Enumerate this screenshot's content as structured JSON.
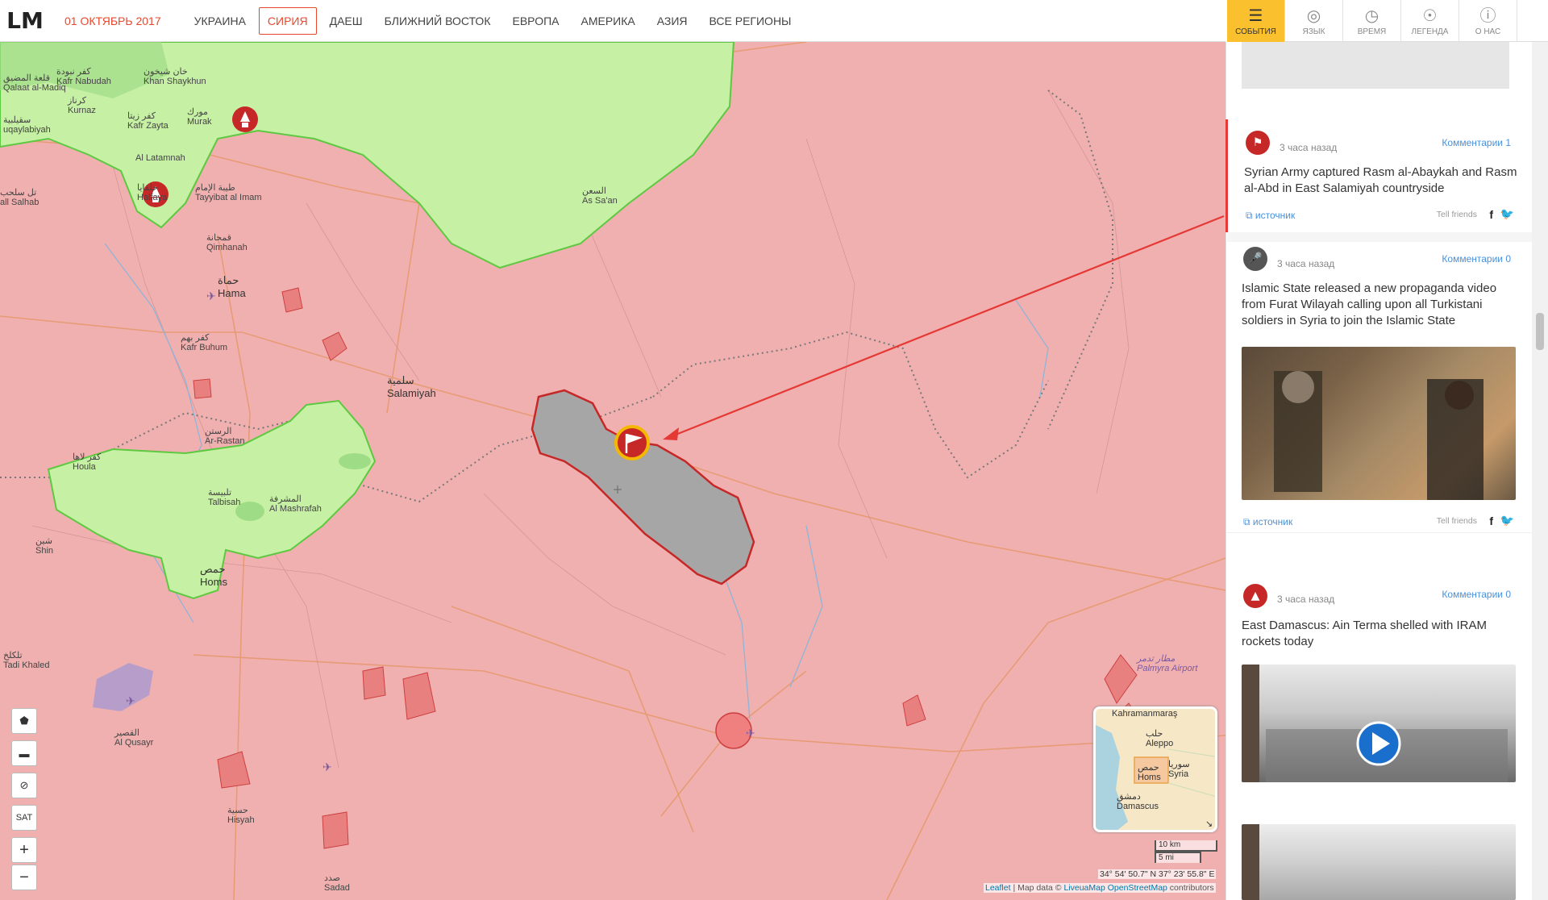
{
  "header": {
    "logo": "LM",
    "date": "01 ОКТЯБРЬ 2017",
    "nav": [
      "УКРАИНА",
      "СИРИЯ",
      "ДАЕШ",
      "БЛИЖНИЙ ВОСТОК",
      "ЕВРОПА",
      "АМЕРИКА",
      "АЗИЯ",
      "ВСЕ РЕГИОНЫ"
    ],
    "active_nav": "СИРИЯ"
  },
  "toolbar": {
    "events_label": "СОБЫТИЯ",
    "language_label": "ЯЗЫК",
    "time_label": "ВРЕМЯ",
    "legend_label": "ЛЕГЕНДА",
    "about_label": "О НАС"
  },
  "map": {
    "places": [
      {
        "name": "Khan Shaykhun",
        "ar": "خان شيخون"
      },
      {
        "name": "Kafr Nabudah",
        "ar": "كفر نبودة"
      },
      {
        "name": "Qalaat al-Madiq",
        "ar": "قلعة المضيق"
      },
      {
        "name": "Kurnaz",
        "ar": "كرناز"
      },
      {
        "name": "Kafr Zayta",
        "ar": "كفر زيتا"
      },
      {
        "name": "Murak",
        "ar": "مورك"
      },
      {
        "name": "uqaylabiyah",
        "ar": "سقيلبية"
      },
      {
        "name": "Al Latamnah",
        "ar": ""
      },
      {
        "name": "Halfaya",
        "ar": "حلفايا"
      },
      {
        "name": "Tayyibat al Imam",
        "ar": "طيبة الإمام"
      },
      {
        "name": "all Salhab",
        "ar": "تل سلحب"
      },
      {
        "name": "Qimhanah",
        "ar": "قمحانة"
      },
      {
        "name": "Hama",
        "ar": "حماة"
      },
      {
        "name": "Kafr Buhum",
        "ar": "كفر بهم"
      },
      {
        "name": "Salamiyah",
        "ar": "سلمية"
      },
      {
        "name": "As Sa'an",
        "ar": "السعن"
      },
      {
        "name": "Ar-Rastan",
        "ar": "الرستن"
      },
      {
        "name": "Houla",
        "ar": "كفر لاها"
      },
      {
        "name": "Talbisah",
        "ar": "تلبيسة"
      },
      {
        "name": "Al Mashrafah",
        "ar": "المشرفة"
      },
      {
        "name": "Shin",
        "ar": "شين"
      },
      {
        "name": "Homs",
        "ar": "حمص"
      },
      {
        "name": "Tadi Khaled",
        "ar": "تلكلخ"
      },
      {
        "name": "Al Qusayr",
        "ar": "القصير"
      },
      {
        "name": "Hisyah",
        "ar": "حسية"
      },
      {
        "name": "Sadad",
        "ar": "صدد"
      },
      {
        "name": "Palmyra Airport",
        "ar": "مطار تدمر"
      }
    ],
    "controls": [
      "SAT",
      "+",
      "−"
    ],
    "minimap": {
      "labels": [
        "Kahramanmaraş",
        "Aleppo",
        "حلب",
        "Syria",
        "سوريا",
        "Homs",
        "حمص",
        "Damascus",
        "دمشق"
      ]
    },
    "scale": [
      "10 km",
      "5 mi"
    ],
    "coords": "34° 54' 50.7\" N 37° 23' 55.8\" E",
    "attribution": {
      "leaflet": "Leaflet",
      "mid": " | Map data © ",
      "lm": "LiveuaMap",
      "osm": "OpenStreetMap",
      "tail": " contributors"
    }
  },
  "feed": {
    "items": [
      {
        "time": "3 часа назад",
        "comments": "Комментарии 1",
        "title": "Syrian Army captured Rasm al-Abaykah and Rasm al-Abd in East Salamiyah countryside",
        "source": "источник",
        "tell": "Tell friends",
        "icon": "flag-icon",
        "color": "#c62828"
      },
      {
        "time": "3 часа назад",
        "comments": "Комментарии 0",
        "title": "Islamic State released a new propaganda video from Furat Wilayah calling upon all Turkistani soldiers in Syria to join the Islamic State",
        "source": "источник",
        "tell": "Tell friends",
        "icon": "microphone-icon",
        "color": "#555555"
      },
      {
        "time": "3 часа назад",
        "comments": "Комментарии 0",
        "title": "East Damascus: Ain Terma shelled with IRAM rockets today",
        "icon": "rocket-icon",
        "color": "#c62828"
      }
    ]
  }
}
